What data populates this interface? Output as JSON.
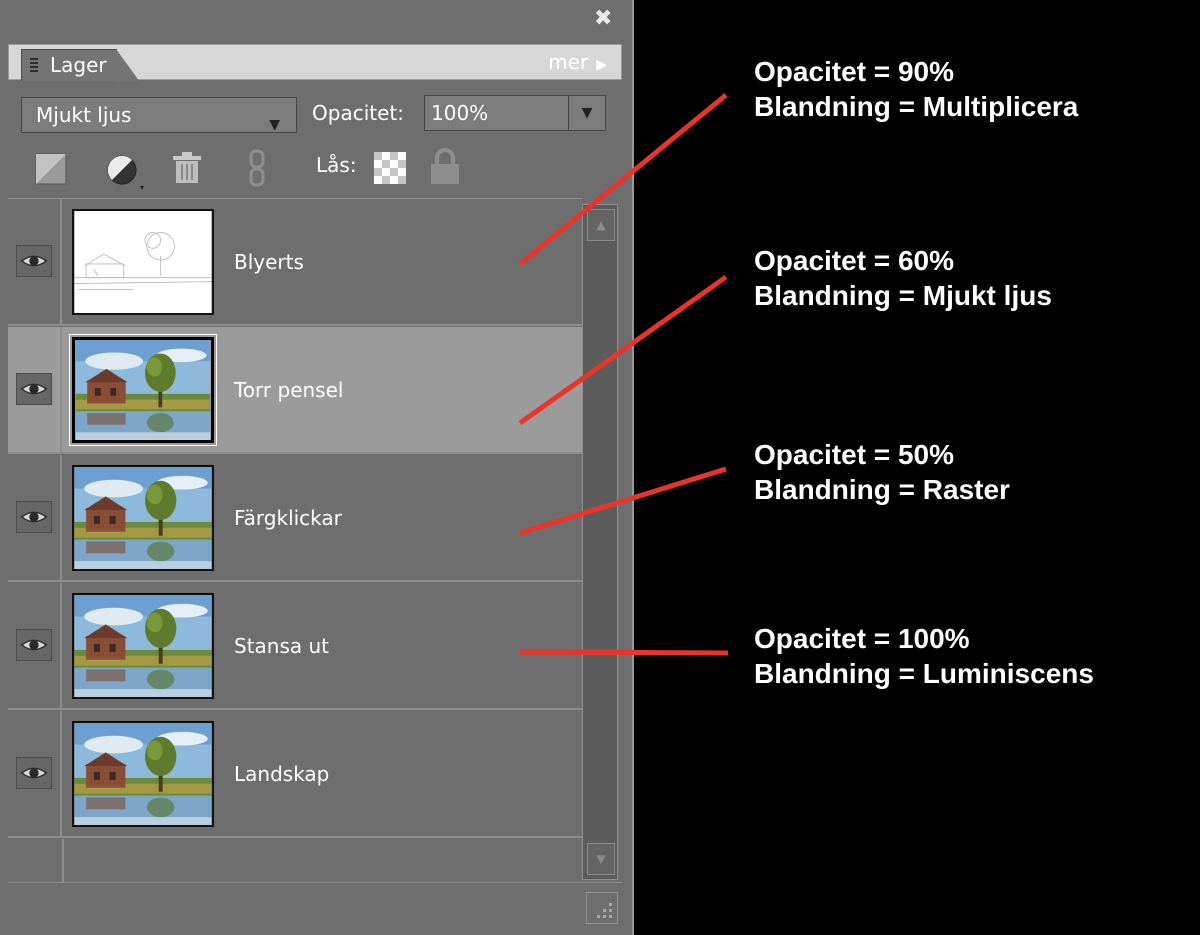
{
  "panel": {
    "tab_label": "Lager",
    "more_label": "mer",
    "blend_mode": "Mjukt ljus",
    "opacity_label": "Opacitet:",
    "opacity_value": "100%",
    "lock_label": "Lås:"
  },
  "layers": [
    {
      "name": "Blyerts",
      "selected": false,
      "thumb": "sketch-thumbnail"
    },
    {
      "name": "Torr pensel",
      "selected": true,
      "thumb": "landscape-thumbnail"
    },
    {
      "name": "Färgklickar",
      "selected": false,
      "thumb": "landscape-thumbnail"
    },
    {
      "name": "Stansa ut",
      "selected": false,
      "thumb": "landscape-thumbnail"
    },
    {
      "name": "Landskap",
      "selected": false,
      "thumb": "landscape-thumbnail"
    }
  ],
  "annotations": [
    {
      "opacity": "Opacitet = 90%",
      "blend": "Blandning = Multiplicera"
    },
    {
      "opacity": "Opacitet = 60%",
      "blend": "Blandning = Mjukt ljus"
    },
    {
      "opacity": "Opacitet = 50%",
      "blend": "Blandning = Raster"
    },
    {
      "opacity": "Opacitet = 100%",
      "blend": "Blandning = Luminiscens"
    }
  ],
  "icons": [
    "close-icon",
    "new-layer-icon",
    "adjustment-layer-icon",
    "trash-icon",
    "link-icon",
    "lock-transparent-icon",
    "lock-icon",
    "eye-icon",
    "scroll-up-icon",
    "scroll-down-icon",
    "resize-grip-icon"
  ],
  "colors": {
    "panel_bg": "#6e6e6e",
    "selected_row": "#9b9b9b",
    "annotation_line": "#e8342a",
    "annotation_text": "#ffffff",
    "background": "#000000"
  }
}
